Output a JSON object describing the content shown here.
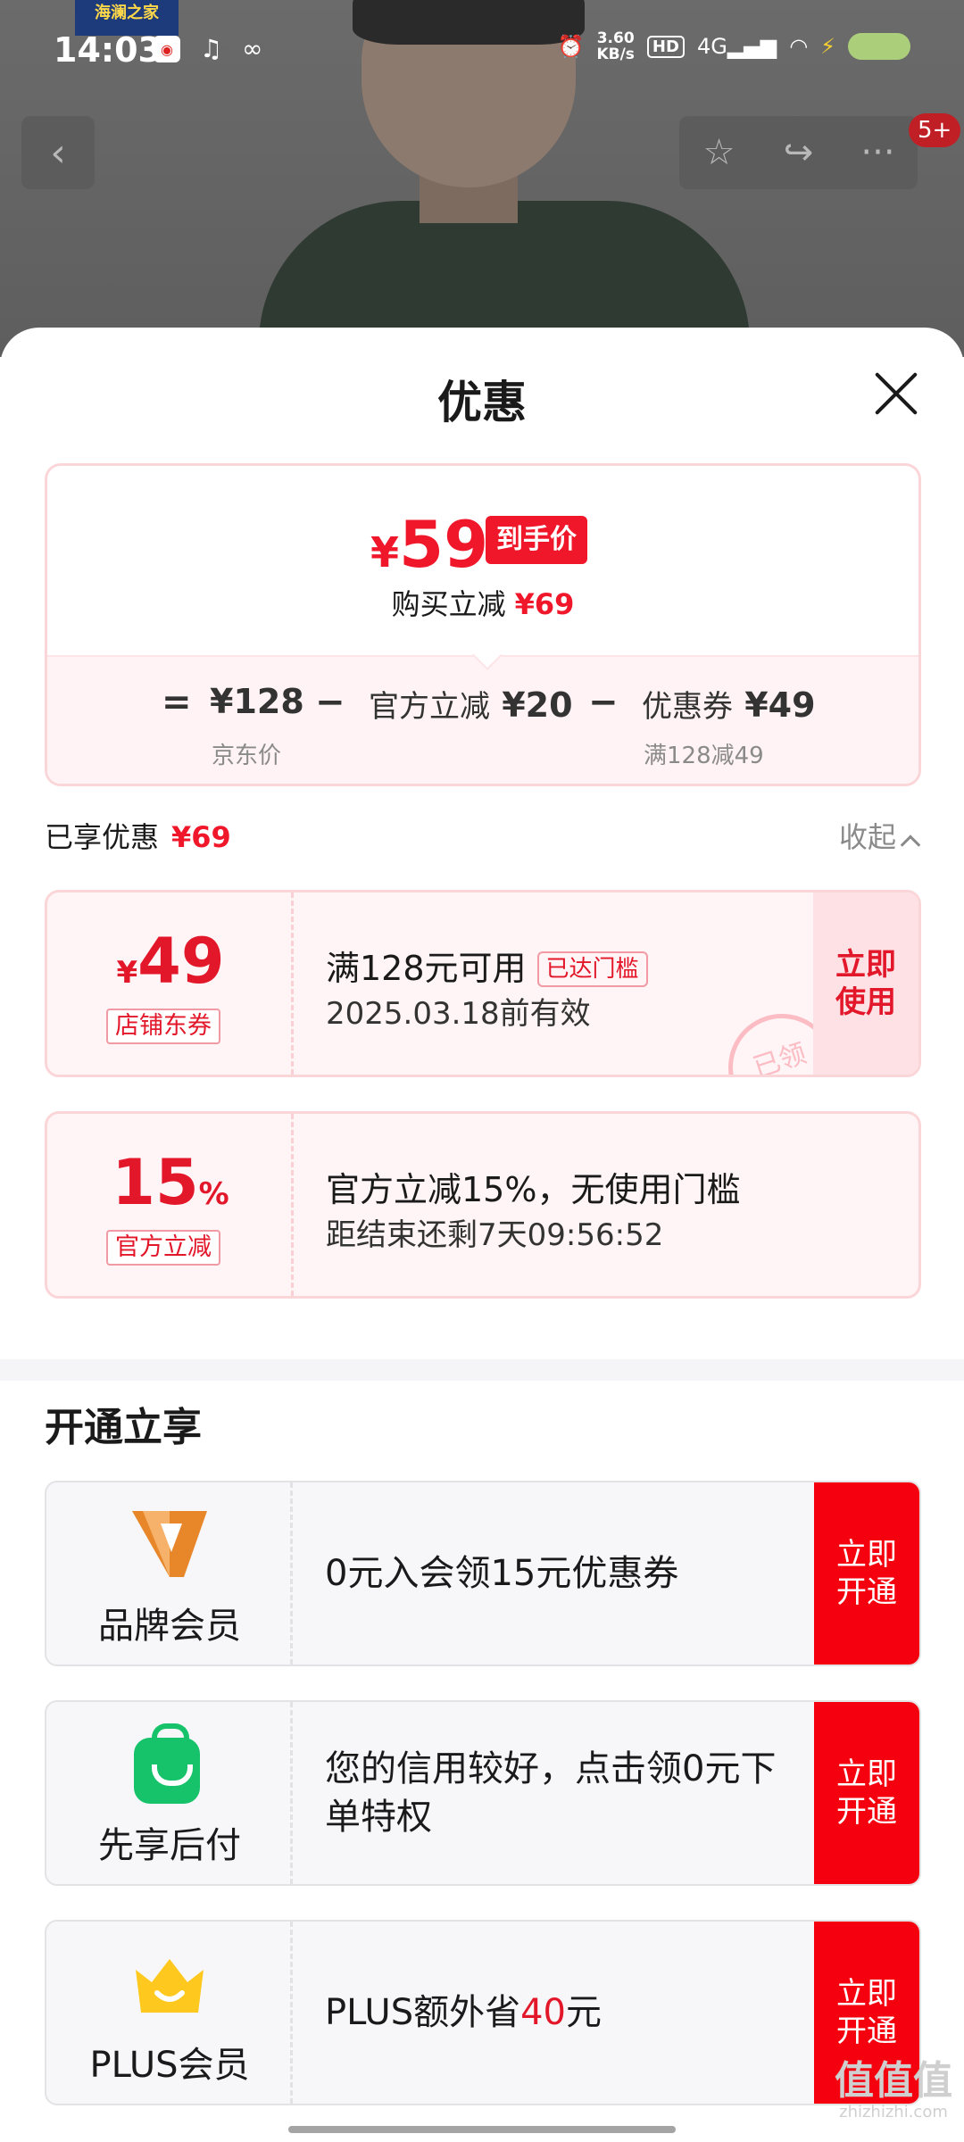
{
  "status_bar": {
    "time": "14:03",
    "net_speed": "3.60",
    "net_unit": "KB/s",
    "hd": "HD",
    "signal": "4G"
  },
  "background": {
    "brand_tag": "海澜之家"
  },
  "nav": {
    "back_icon": "‹",
    "favorite_icon": "☆",
    "share_icon": "↪",
    "more_icon": "···",
    "badge": "5+"
  },
  "sheet": {
    "title": "优惠"
  },
  "price_summary": {
    "final_currency": "¥",
    "final_price": "59",
    "final_tag": "到手价",
    "reduce_label": "购买立减",
    "reduce_amount": "¥69",
    "formula": {
      "equals": "=",
      "jd_price": "¥128",
      "jd_price_label": "京东价",
      "minus1": "−",
      "official_label": "官方立减",
      "official_amount": "¥20",
      "minus2": "−",
      "coupon_label": "优惠券",
      "coupon_amount": "¥49",
      "coupon_condition": "满128减49"
    }
  },
  "enjoyed": {
    "label": "已享优惠",
    "amount": "¥69",
    "collapse_label": "收起"
  },
  "coupons": [
    {
      "currency": "¥",
      "value": "49",
      "suffix": "",
      "tag": "店铺东券",
      "main": "满128元可用",
      "reached": "已达门槛",
      "sub": "2025.03.18前有效",
      "action": "立即使用",
      "stamp": "已领"
    },
    {
      "currency": "",
      "value": "15",
      "suffix": "%",
      "tag": "官方立减",
      "main": "官方立减15%，无使用门槛",
      "sub": "距结束还剩7天09:56:52"
    }
  ],
  "open_section": {
    "title": "开通立享",
    "items": [
      {
        "logo": "brand-v-icon",
        "label": "品牌会员",
        "desc": "0元入会领15元优惠券",
        "action": "立即开通"
      },
      {
        "logo": "shopping-bag-icon",
        "label": "先享后付",
        "desc": "您的信用较好，点击领0元下单特权",
        "action": "立即开通"
      },
      {
        "logo": "crown-icon",
        "label": "PLUS会员",
        "desc_prefix": "PLUS额外省",
        "desc_highlight": "40",
        "desc_suffix": "元",
        "action": "立即开通"
      }
    ]
  },
  "watermark": {
    "main": "值值值",
    "small": "zhizhizhi.com"
  },
  "colors": {
    "accent_red": "#f0172a",
    "open_red": "#f5000f",
    "card_border": "#fbd6d9",
    "coupon_bg": "#fff4f6"
  }
}
